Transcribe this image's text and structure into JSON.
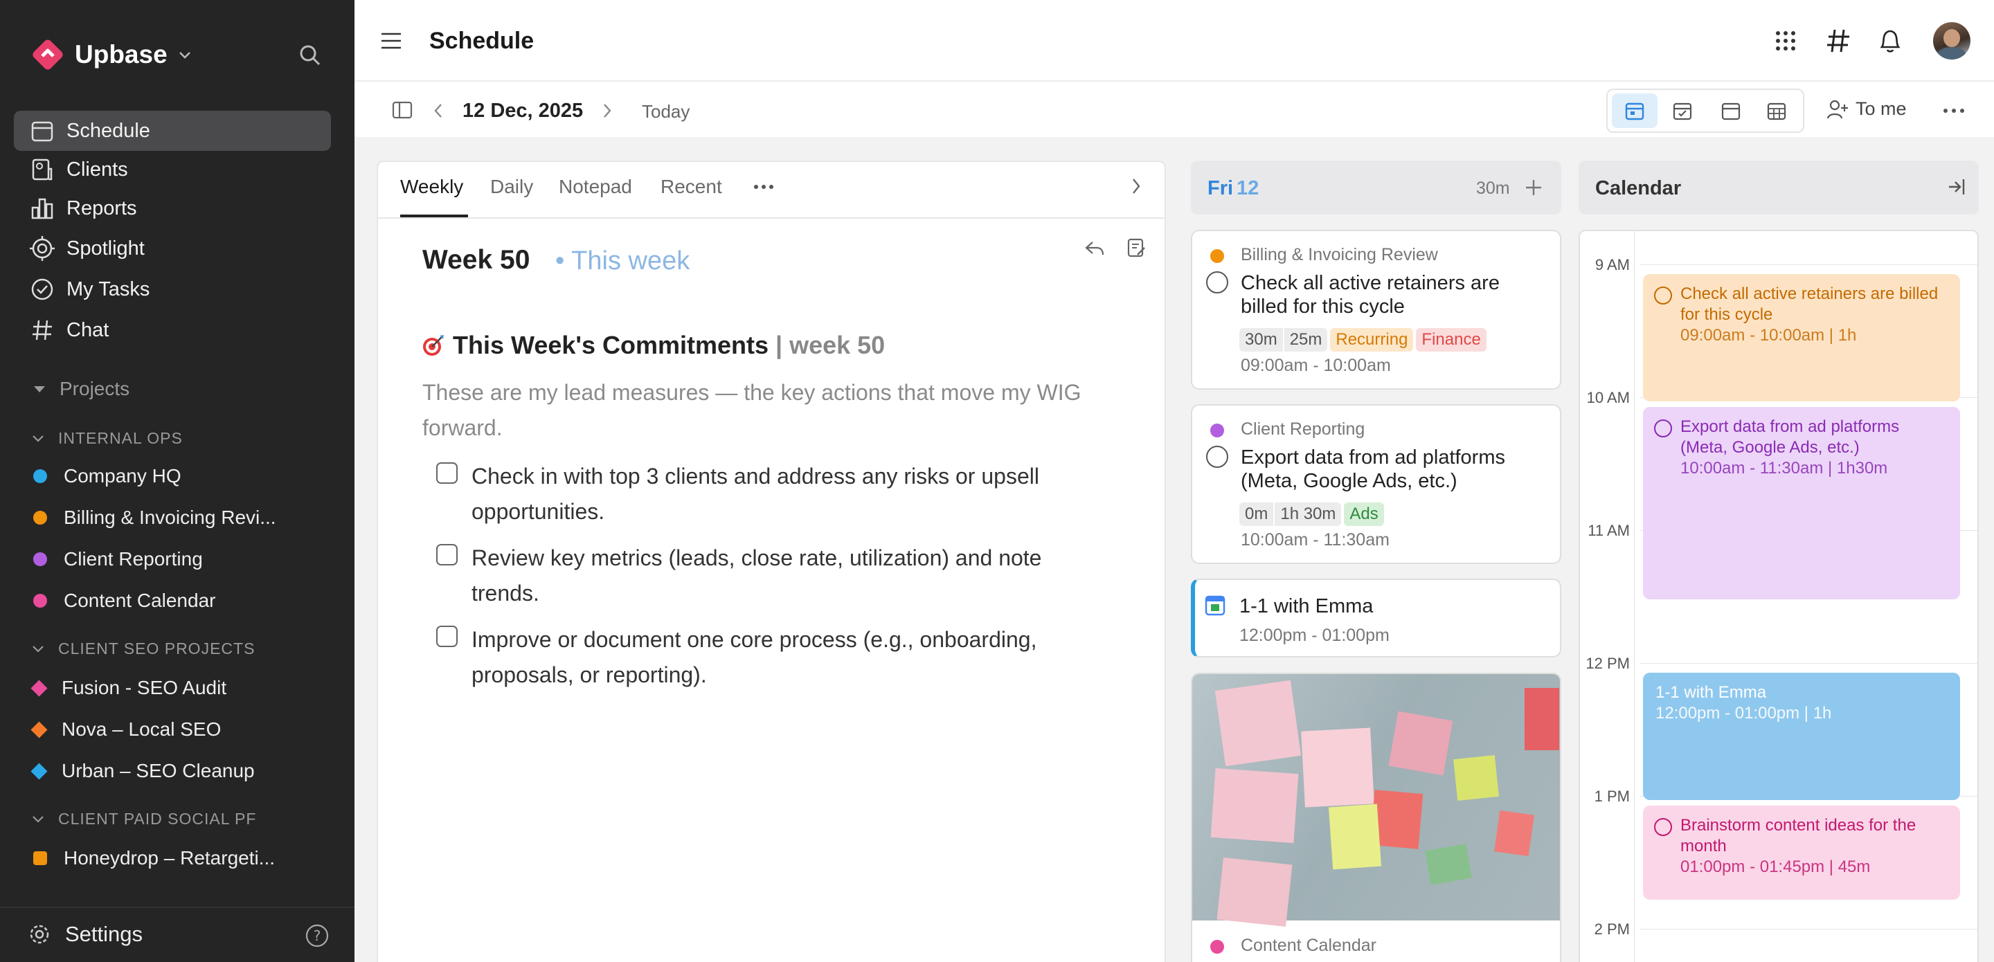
{
  "app": {
    "name": "Upbase"
  },
  "sidebar": {
    "nav": [
      {
        "label": "Schedule",
        "icon": "calendar-icon"
      },
      {
        "label": "Clients",
        "icon": "clients-icon"
      },
      {
        "label": "Reports",
        "icon": "bar-chart-icon"
      },
      {
        "label": "Spotlight",
        "icon": "target-icon"
      },
      {
        "label": "My Tasks",
        "icon": "check-circle-icon"
      },
      {
        "label": "Chat",
        "icon": "hash-icon"
      }
    ],
    "projects_label": "Projects",
    "groups": [
      {
        "label": "INTERNAL OPS",
        "items": [
          {
            "label": "Company HQ",
            "color": "#2aa8e8",
            "shape": "dot"
          },
          {
            "label": "Billing & Invoicing Revi...",
            "color": "#f2930d",
            "shape": "dot"
          },
          {
            "label": "Client Reporting",
            "color": "#b15fe0",
            "shape": "dot"
          },
          {
            "label": "Content Calendar",
            "color": "#e94c9a",
            "shape": "dot"
          }
        ]
      },
      {
        "label": "CLIENT SEO PROJECTS",
        "items": [
          {
            "label": "Fusion - SEO Audit",
            "color": "#e94c9a",
            "shape": "dia"
          },
          {
            "label": "Nova – Local SEO",
            "color": "#f47a2a",
            "shape": "dia"
          },
          {
            "label": "Urban – SEO Cleanup",
            "color": "#2aa8e8",
            "shape": "dia"
          }
        ]
      },
      {
        "label": "CLIENT PAID SOCIAL PF",
        "items": [
          {
            "label": "Honeydrop – Retargeti...",
            "color": "#f2930d",
            "shape": "sq"
          }
        ]
      }
    ],
    "settings_label": "Settings"
  },
  "header": {
    "title": "Schedule"
  },
  "toolbar": {
    "date": "12 Dec, 2025",
    "today": "Today",
    "assignee": "To me"
  },
  "notes": {
    "tabs": [
      "Weekly",
      "Daily",
      "Notepad",
      "Recent"
    ],
    "week_title": "Week 50",
    "week_sub": "• This week",
    "heading": "This Week's Commitments",
    "heading_suffix": " | week 50",
    "description": "These are my lead measures — the key actions that move my WIG forward.",
    "commitments": [
      "Check in with top 3 clients and address any risks or upsell opportunities.",
      "Review key metrics (leads, close rate, utilization) and note trends.",
      "Improve or document one core process (e.g., onboarding, proposals, or reporting)."
    ]
  },
  "day": {
    "label": "Fri",
    "num": "12",
    "total": "30m",
    "tasks": [
      {
        "project": "Billing & Invoicing Review",
        "project_color": "#f2930d",
        "title": "Check all active retainers are billed for this cycle",
        "est": "30m",
        "spent": "25m",
        "tags": [
          {
            "label": "Recurring",
            "bg": "#fde7c9",
            "fg": "#d57a06"
          },
          {
            "label": "Finance",
            "bg": "#fbdcdc",
            "fg": "#e04848"
          }
        ],
        "time": "09:00am - 10:00am"
      },
      {
        "project": "Client Reporting",
        "project_color": "#b15fe0",
        "title": "Export data from ad platforms (Meta, Google Ads, etc.)",
        "est": "0m",
        "spent": "1h 30m",
        "tags": [
          {
            "label": "Ads",
            "bg": "#d6f0d8",
            "fg": "#2f8a3c"
          }
        ],
        "time": "10:00am - 11:30am"
      }
    ],
    "meeting": {
      "title": "1-1 with Emma",
      "time": "12:00pm - 01:00pm"
    },
    "last_project": "Content Calendar"
  },
  "calendar": {
    "title": "Calendar",
    "hours": [
      "9 AM",
      "10 AM",
      "11 AM",
      "12 PM",
      "1 PM",
      "2 PM"
    ],
    "events": [
      {
        "title": "Check all active retainers are billed for this cycle",
        "time": "09:00am - 10:00am | 1h",
        "bg": "#fde3c4",
        "fg": "#c46a00"
      },
      {
        "title": "Export data from ad platforms (Meta, Google Ads, etc.)",
        "time": "10:00am - 11:30am | 1h30m",
        "bg": "#ecd5f8",
        "fg": "#8a2bb5"
      },
      {
        "title": "1-1 with Emma",
        "time": "12:00pm - 01:00pm | 1h",
        "bg": "#8fc8ee",
        "fg": "#ffffff"
      },
      {
        "title": "Brainstorm content ideas for the month",
        "time": "01:00pm - 01:45pm | 45m",
        "bg": "#fbd6e9",
        "fg": "#c2186e"
      }
    ]
  }
}
